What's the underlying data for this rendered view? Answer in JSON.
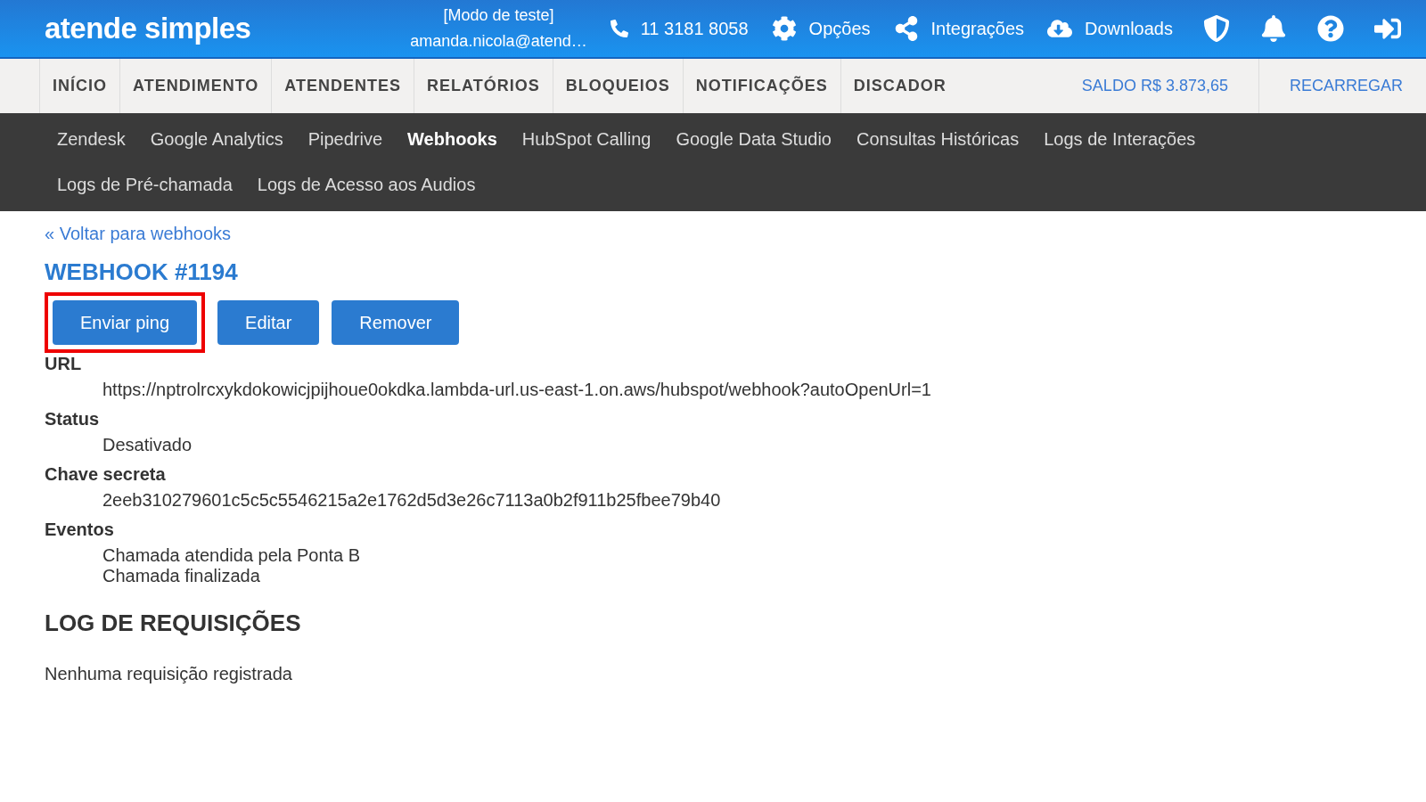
{
  "header": {
    "logo": "atende simples",
    "mode": "[Modo de teste]",
    "user": "amanda.nicola@atend…",
    "phone": "11 3181 8058",
    "links": [
      {
        "kind": "options",
        "label": "Opções"
      },
      {
        "kind": "share",
        "label": "Integrações"
      },
      {
        "kind": "download",
        "label": "Downloads"
      }
    ]
  },
  "nav": {
    "items": [
      "INÍCIO",
      "ATENDIMENTO",
      "ATENDENTES",
      "RELATÓRIOS",
      "BLOQUEIOS",
      "NOTIFICAÇÕES",
      "DISCADOR"
    ],
    "balance": "SALDO R$ 3.873,65",
    "recharge": "RECARREGAR"
  },
  "subnav": [
    {
      "label": "Zendesk",
      "selected": false
    },
    {
      "label": "Google Analytics",
      "selected": false
    },
    {
      "label": "Pipedrive",
      "selected": false
    },
    {
      "label": "Webhooks",
      "selected": true
    },
    {
      "label": "HubSpot Calling",
      "selected": false
    },
    {
      "label": "Google Data Studio",
      "selected": false
    },
    {
      "label": "Consultas Históricas",
      "selected": false
    },
    {
      "label": "Logs de Interações",
      "selected": false
    },
    {
      "label": "Logs de Pré-chamada",
      "selected": false
    },
    {
      "label": "Logs de Acesso aos Audios",
      "selected": false
    }
  ],
  "back_link": "« Voltar para webhooks",
  "title": "WEBHOOK #1194",
  "buttons": [
    {
      "label": "Enviar ping",
      "highlighted": true
    },
    {
      "label": "Editar",
      "highlighted": false
    },
    {
      "label": "Remover",
      "highlighted": false
    }
  ],
  "details": [
    {
      "label": "URL",
      "values": [
        "https://nptrolrcxykdokowicjpijhoue0okdka.lambda-url.us-east-1.on.aws/hubspot/webhook?autoOpenUrl=1"
      ]
    },
    {
      "label": "Status",
      "values": [
        "Desativado"
      ]
    },
    {
      "label": "Chave secreta",
      "values": [
        "2eeb310279601c5c5c5546215a2e1762d5d3e26c7113a0b2f911b25fbee79b40"
      ]
    },
    {
      "label": "Eventos",
      "values": [
        "Chamada atendida pela Ponta B",
        "Chamada finalizada"
      ]
    }
  ],
  "log": {
    "title": "LOG DE REQUISIÇÕES",
    "empty": "Nenhuma requisição registrada"
  }
}
